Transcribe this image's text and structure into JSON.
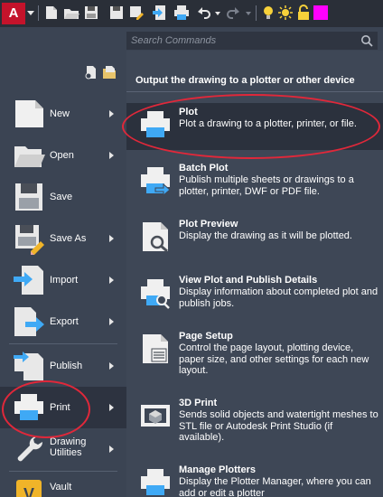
{
  "toolbar": {
    "app_letter": "A",
    "icons": [
      "new-icon",
      "open-icon",
      "save-icon",
      "save-as-icon",
      "publish-icon",
      "print-icon",
      "undo-icon",
      "redo-icon",
      "light-bulb-icon",
      "sun-icon",
      "lock-icon",
      "color-swatch-icon"
    ],
    "accent_color": "#c4132b",
    "swatch_color": "#ff00ff"
  },
  "search": {
    "placeholder": "Search Commands"
  },
  "left_menu": {
    "items": [
      {
        "label": "New",
        "has_submenu": true
      },
      {
        "label": "Open",
        "has_submenu": true
      },
      {
        "label": "Save",
        "has_submenu": false
      },
      {
        "label": "Save As",
        "has_submenu": true
      },
      {
        "label": "Import",
        "has_submenu": true
      },
      {
        "label": "Export",
        "has_submenu": true
      },
      {
        "label": "Publish",
        "has_submenu": true
      },
      {
        "label": "Print",
        "has_submenu": true,
        "selected": true
      },
      {
        "label": "Drawing Utilities",
        "has_submenu": true
      },
      {
        "label": "Vault",
        "has_submenu": false
      }
    ]
  },
  "right_panel": {
    "title": "Output the drawing to a plotter or other device",
    "commands": [
      {
        "title": "Plot",
        "description": "Plot a drawing to a plotter, printer, or file.",
        "selected": true
      },
      {
        "title": "Batch Plot",
        "description": "Publish multiple sheets or drawings to a plotter, printer, DWF or PDF file."
      },
      {
        "title": "Plot Preview",
        "description": "Display the drawing as it will be plotted."
      },
      {
        "title": "View Plot and Publish Details",
        "description": "Display information about completed plot and publish jobs."
      },
      {
        "title": "Page Setup",
        "description": "Control the page layout, plotting device, paper size, and other settings for each new layout."
      },
      {
        "title": "3D Print",
        "description": "Sends solid objects and watertight meshes to STL file or Autodesk Print Studio (if available)."
      },
      {
        "title": "Manage Plotters",
        "description": "Display the Plotter Manager, where you can add or edit a plotter"
      }
    ]
  },
  "highlight_color": "#e0283a"
}
